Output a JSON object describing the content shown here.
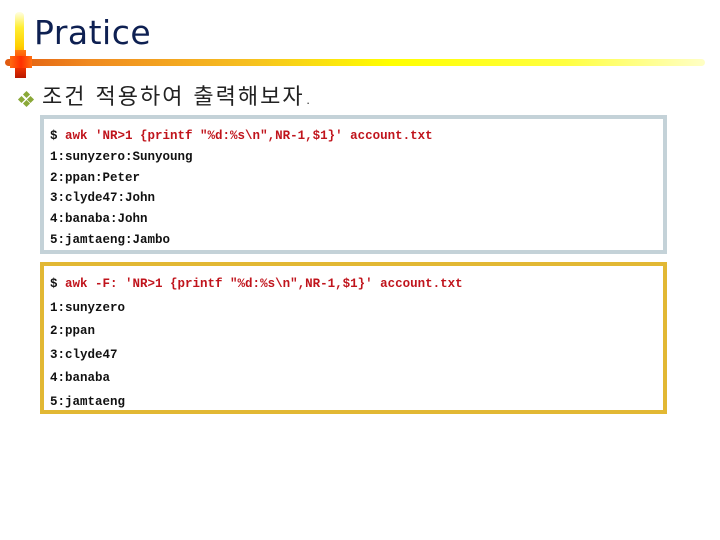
{
  "slide": {
    "title": "Pratice",
    "subtitle": "조건 적용하여 출력해보자.",
    "bullet_icon": "diamond-dots-bullet",
    "colors": {
      "title": "#0e2052",
      "command": "#c0141c",
      "box1_border": "#c4d2d8",
      "box2_border": "#e2b834",
      "bullet": "#8aa838"
    }
  },
  "box1": {
    "prompt": "$",
    "command": "awk 'NR>1 {printf \"%d:%s\\n\",NR-1,$1}' account.txt",
    "output": [
      "1:sunyzero:Sunyoung",
      "2:ppan:Peter",
      "3:clyde47:John",
      "4:banaba:John",
      "5:jamtaeng:Jambo"
    ]
  },
  "box2": {
    "prompt": "$",
    "command": "awk -F: 'NR>1 {printf \"%d:%s\\n\",NR-1,$1}' account.txt",
    "output": [
      "1:sunyzero",
      "2:ppan",
      "3:clyde47",
      "4:banaba",
      "5:jamtaeng"
    ]
  }
}
